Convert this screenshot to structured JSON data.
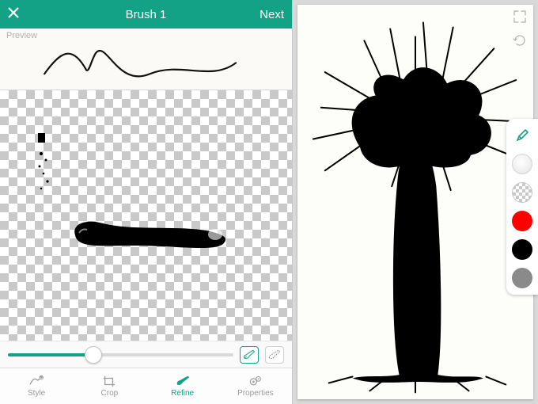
{
  "header": {
    "title": "Brush 1",
    "next_label": "Next",
    "close_label": "Close"
  },
  "preview": {
    "label": "Preview"
  },
  "slider": {
    "value_pct": 38,
    "toggles": {
      "paint_active": true,
      "erase_active": false
    }
  },
  "tabs": [
    {
      "id": "style",
      "label": "Style",
      "active": false
    },
    {
      "id": "crop",
      "label": "Crop",
      "active": false
    },
    {
      "id": "refine",
      "label": "Refine",
      "active": true
    },
    {
      "id": "properties",
      "label": "Properties",
      "active": false
    }
  ],
  "tool_dock": [
    {
      "id": "pencil",
      "kind": "icon",
      "icon": "pencil-icon"
    },
    {
      "id": "soft",
      "kind": "swatch",
      "color": "radial-white"
    },
    {
      "id": "checker",
      "kind": "swatch",
      "color": "checker"
    },
    {
      "id": "red",
      "kind": "swatch",
      "color": "#ff0000"
    },
    {
      "id": "black",
      "kind": "swatch",
      "color": "#000000"
    },
    {
      "id": "gray",
      "kind": "swatch",
      "color": "#8a8a8a"
    }
  ],
  "canvas_icons": {
    "expand": "expand-icon",
    "refresh": "refresh-icon"
  },
  "colors": {
    "accent": "#14a286"
  }
}
